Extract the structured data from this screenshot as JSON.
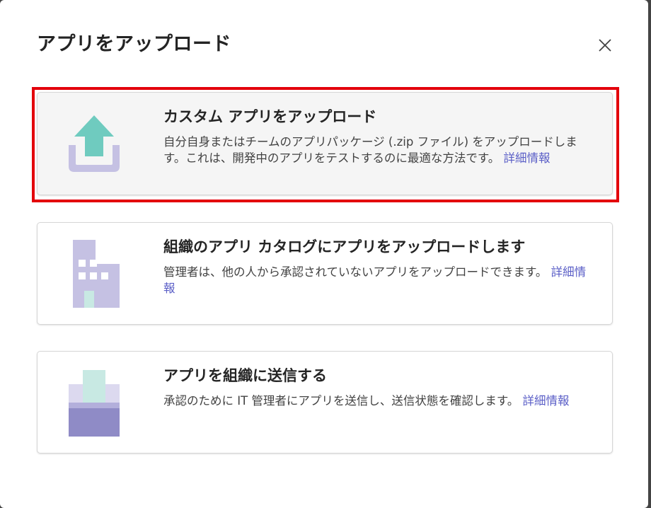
{
  "dialog": {
    "title": "アプリをアップロード",
    "close_icon": "close-icon"
  },
  "options": [
    {
      "icon": "upload-arrow-icon",
      "title": "カスタム アプリをアップロード",
      "description": "自分自身またはチームのアプリパッケージ (.zip ファイル) をアップロードします。これは、開発中のアプリをテストするのに最適な方法です。",
      "link": "詳細情報",
      "selected": true
    },
    {
      "icon": "office-building-icon",
      "title": "組織のアプリ カタログにアプリをアップロードします",
      "description": "管理者は、他の人から承認されていないアプリをアップロードできます。",
      "link": "詳細情報",
      "selected": false
    },
    {
      "icon": "submit-box-icon",
      "title": "アプリを組織に送信する",
      "description": "承認のために IT 管理者にアプリを送信し、送信状態を確認します。",
      "link": "詳細情報",
      "selected": false
    }
  ],
  "colors": {
    "highlight": "#e3000b",
    "link": "#5b5fc7",
    "icon_teal": "#6fcbbf",
    "icon_lavender": "#c5c1e3",
    "icon_purple": "#8f8bc6"
  }
}
